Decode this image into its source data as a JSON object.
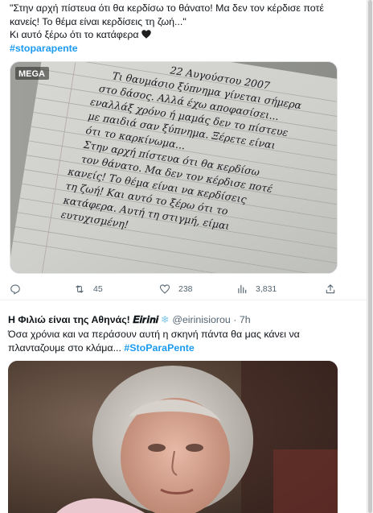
{
  "tweet1": {
    "text_lines": [
      "\"Στην αρχή πίστευα ότι θα κερδίσω το θάνατο! Μα δεν τον κέρδισε ποτέ",
      "κανείς! Το θέμα είναι κερδίσεις τη ζωή...\"",
      "Κι αυτό ξέρω ότι το κατάφερα"
    ],
    "heart_emoji": "black-heart-icon",
    "hashtag": "#stoparapente",
    "media": {
      "channel_logo": "MEGA",
      "handwriting_lines": [
        "22 Αυγούστου 2007",
        "Τι θαυμάσιο ξύπνημα γίνεται σήμερα",
        "στο δάσος. Αλλά έχω αποφασίσει...",
        "εναλλάξ χρόνο ή μαμάς δεν το πίστευε",
        "με παιδιά σαν ξύπνημα. Ξέρετε είναι",
        "ότι το καρκίνωμα...",
        "Στην αρχή πίστευα ότι θα κερδίσω",
        "τον θάνατο. Μα δεν τον κέρδισε ποτέ",
        "κανείς! Το θέμα είναι να κερδίσεις",
        "τη ζωή! Και αυτό το ξέρω ότι το",
        "κατάφερα. Αυτή τη στιγμή, είμαι",
        "ευτυχισμένη!"
      ]
    },
    "actions": {
      "reply": {
        "icon": "reply-icon",
        "count": ""
      },
      "retweet": {
        "icon": "retweet-icon",
        "count": "45"
      },
      "like": {
        "icon": "heart-outline-icon",
        "count": "238"
      },
      "views": {
        "icon": "views-chart-icon",
        "count": "3,831"
      },
      "share": {
        "icon": "share-icon",
        "count": ""
      }
    }
  },
  "tweet2": {
    "display_name": "Η Φιλιώ είναι της Αθηνάς! 𝑬𝒊𝒓𝒊𝒏𝒊",
    "name_emoji": "❄",
    "handle_time": "@eirinisiorou · 7h",
    "text_lines": [
      "Όσα χρόνια και να περάσουν αυτή η σκηνή πάντα θα μας κάνει να",
      "πλανταζουμε στο κλάμα..."
    ],
    "hashtag": "#StoParaPente"
  },
  "colors": {
    "accent": "#1d9bf0",
    "text": "#0f1419",
    "muted": "#536471"
  }
}
